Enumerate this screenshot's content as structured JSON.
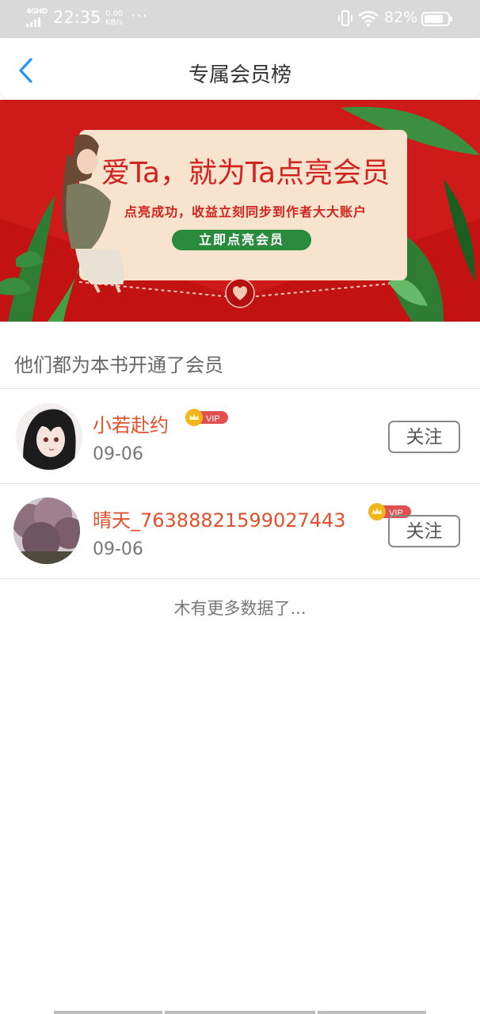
{
  "status_bar": {
    "network": "4GHD",
    "time": "22:35",
    "speed_value": "0.00",
    "speed_unit": "KB/s",
    "more": "···",
    "battery_percent": "82%",
    "battery_level": 0.82,
    "icons": [
      "signal-icon",
      "vibrate-icon",
      "wifi-icon",
      "battery-icon"
    ]
  },
  "nav": {
    "back_icon": "chevron-left-icon",
    "title": "专属会员榜",
    "accent": "#2196f3"
  },
  "banner": {
    "title": "爱Ta，就为Ta点亮会员",
    "subtitle": "点亮成功，收益立刻同步到作者大大账户",
    "cta": "立即点亮会员",
    "background": "#cf1a1a",
    "illustration": "woman-reading-illustration",
    "seal_icon": "heart-seal-icon"
  },
  "section": {
    "title": "他们都为本书开通了会员"
  },
  "members": [
    {
      "avatar": "anime-girl-avatar",
      "name": "小若赴约",
      "badge": "VIP",
      "date": "09-06",
      "follow_label": "关注"
    },
    {
      "avatar": "flower-tree-avatar",
      "name": "晴天_76388821599027443",
      "badge": "VIP",
      "date": "09-06",
      "follow_label": "关注"
    }
  ],
  "footer": {
    "no_more": "木有更多数据了..."
  },
  "colors": {
    "name": "#e1502b",
    "vip_badge": "#e05050",
    "crown": "#f2b61c",
    "cta_green": "#2a8a3e"
  }
}
